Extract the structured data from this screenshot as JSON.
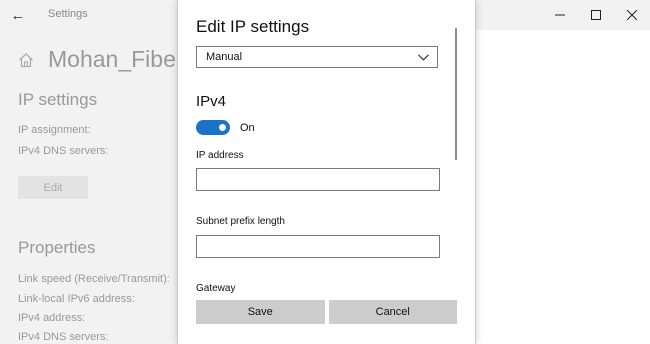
{
  "window": {
    "title": "Settings",
    "controls": [
      "minimize",
      "maximize",
      "close"
    ]
  },
  "background": {
    "network_name": "Mohan_Fibern",
    "ip_settings": {
      "heading": "IP settings",
      "fields": [
        "IP assignment:",
        "IPv4 DNS servers:"
      ],
      "edit_label": "Edit"
    },
    "properties": {
      "heading": "Properties",
      "fields": [
        "Link speed (Receive/Transmit):",
        "Link-local IPv6 address:",
        "IPv4 address:",
        "IPv4 DNS servers:"
      ]
    }
  },
  "dialog": {
    "title": "Edit IP settings",
    "mode_select": {
      "value": "Manual"
    },
    "ipv4": {
      "heading": "IPv4",
      "toggle_label": "On",
      "toggle_on": true
    },
    "fields": {
      "ip_address_label": "IP address",
      "ip_address_value": "",
      "subnet_label": "Subnet prefix length",
      "subnet_value": "",
      "gateway_label": "Gateway"
    },
    "buttons": {
      "save": "Save",
      "cancel": "Cancel"
    }
  },
  "colors": {
    "accent": "#1a73c8",
    "background_window": "#f2f2f2",
    "button_gray": "#cccccc"
  }
}
